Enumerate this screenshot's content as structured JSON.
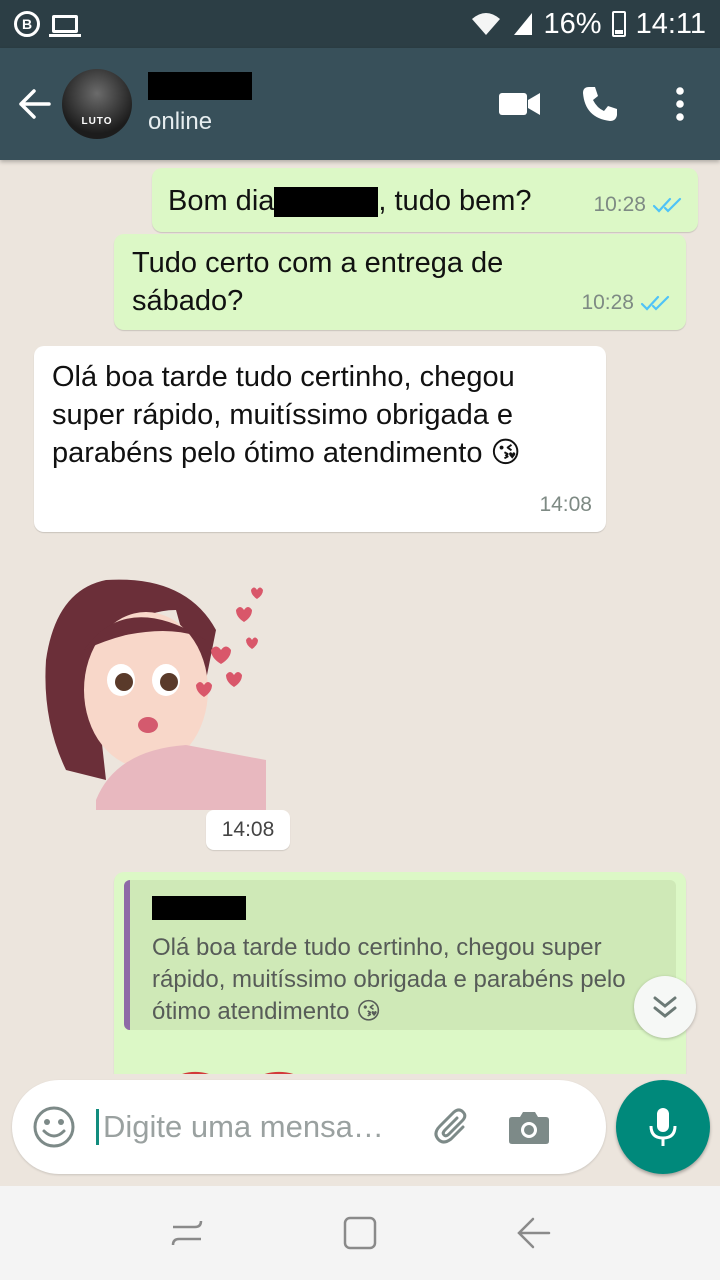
{
  "status_bar": {
    "battery": "16%",
    "time": "14:11",
    "icons": [
      "b-icon",
      "laptop-icon",
      "wifi-icon",
      "signal-icon",
      "battery-icon"
    ]
  },
  "header": {
    "avatar_text": "LUTO",
    "status": "online",
    "icons": [
      "back-arrow-icon",
      "video-call-icon",
      "phone-icon",
      "more-vert-icon"
    ]
  },
  "messages": [
    {
      "type": "out",
      "text_before": "Bom dia",
      "text_after": ", tudo bem?",
      "time": "10:28",
      "ticks": "read"
    },
    {
      "type": "out",
      "text": "Tudo certo com a entrega de sábado?",
      "time": "10:28",
      "ticks": "read"
    },
    {
      "type": "in",
      "text": "Olá boa tarde tudo certinho, chegou super rápido, muitíssimo obrigada e parabéns pelo ótimo atendimento 😘",
      "time": "14:08"
    },
    {
      "type": "sticker",
      "time": "14:08"
    },
    {
      "type": "out-reply",
      "quoted_text": "Olá boa tarde tudo certinho, chegou super rápido, muitíssimo obrigada e parabéns pelo ótimo atendimento 😘"
    }
  ],
  "input": {
    "placeholder": "Digite uma mensa…"
  },
  "colors": {
    "header": "#38505a",
    "outgoing_bubble": "#dcf8c6",
    "incoming_bubble": "#ffffff",
    "accent": "#00897b",
    "read_ticks": "#4fc3f7"
  }
}
